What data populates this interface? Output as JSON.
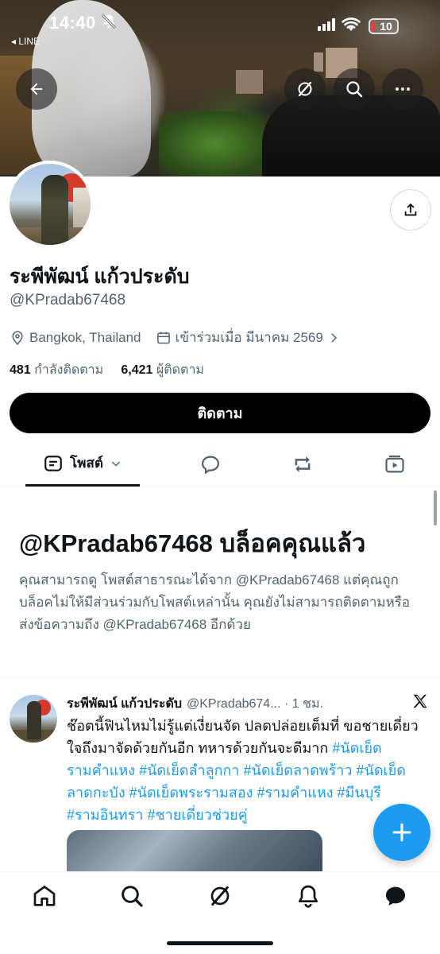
{
  "status_bar": {
    "time": "14:40",
    "back_app": "◂ LINE",
    "battery": "10"
  },
  "profile": {
    "display_name": "ระพีพัฒน์ แก้วประดับ",
    "handle": "@KPradab67468",
    "location": "Bangkok, Thailand",
    "joined": "เข้าร่วมเมื่อ มีนาคม 2569",
    "following_count": "481",
    "following_label": "กำลังติดตาม",
    "followers_count": "6,421",
    "followers_label": "ผู้ติดตาม",
    "follow_label": "ติดตาม"
  },
  "tabs": {
    "posts_label": "โพสต์"
  },
  "blocked": {
    "title": "@KPradab67468 บล็อคคุณแล้ว",
    "description": "คุณสามารถดู โพสต์สาธารณะได้จาก @KPradab67468 แต่คุณถูกบล็อคไม่ให้มีส่วนร่วมกับโพสต์เหล่านั้น คุณยังไม่สามารถติดตามหรือส่งข้อความถึง @KPradab67468 อีกด้วย"
  },
  "post": {
    "author_name": "ระพีพัฒน์ แก้วประดับ",
    "author_handle": "@KPradab674...",
    "time": "· 1 ชม.",
    "text": "ช๊อตนี้ฟินไหมไม่รู้แต่เงี่ยนจัด ปลดปล่อยเต็มที่ ขอชายเดี่ยว ใจถึงมาจัดด้วยกันอีก ทหารด้วยกันจะดีมาก",
    "hashtags": [
      "#นัดเย็ดรามคำแหง",
      "#นัดเย็ดลำลูกกา",
      "#นัดเย็ดลาดพร้าว",
      "#นัดเย็ดลาดกะบัง",
      "#นัดเย็ดพระรามสอง",
      "#รามคำแหง",
      "#มีนบุรี",
      "#รามอินทรา",
      "#ชายเดี่ยวช่วยคู่"
    ]
  },
  "icons": {
    "back": "arrow-left-icon",
    "grok": "grok-icon",
    "search": "search-icon",
    "more": "more-icon",
    "share": "share-icon",
    "location": "location-pin-icon",
    "calendar": "calendar-icon",
    "compose": "plus-icon",
    "nav": [
      "home-icon",
      "search-icon",
      "grok-icon",
      "bell-icon",
      "messages-icon"
    ]
  },
  "colors": {
    "accent": "#1d9bf0",
    "text_primary": "#0f1419",
    "text_secondary": "#536471"
  }
}
